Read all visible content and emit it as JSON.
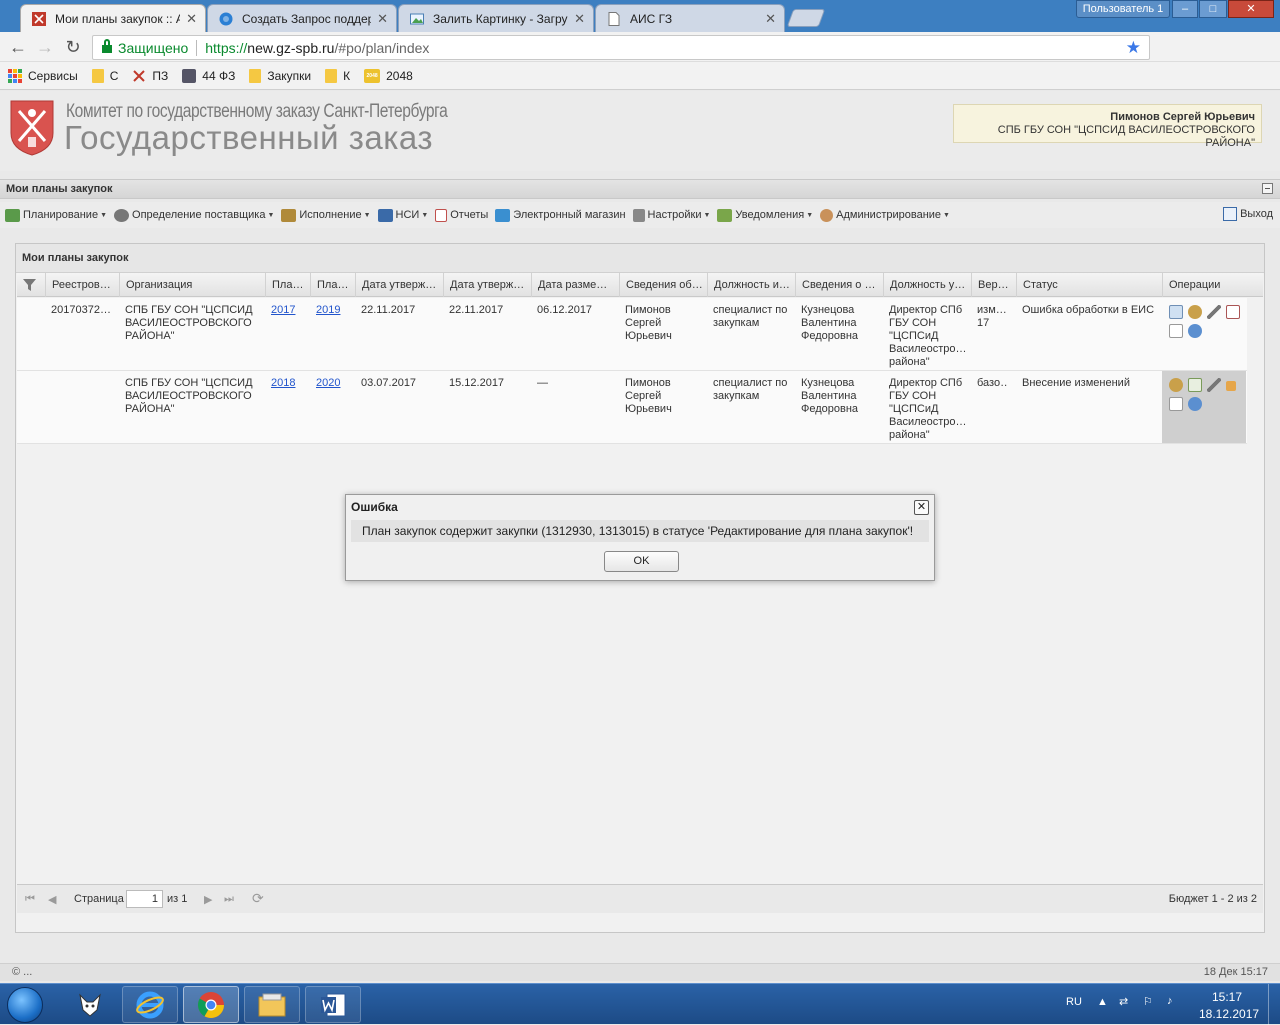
{
  "browser": {
    "tabs": [
      {
        "title": "Мои планы закупок :: АИС",
        "active": true
      },
      {
        "title": "Создать Запрос поддер",
        "active": false
      },
      {
        "title": "Залить Картинку - Загру",
        "active": false
      },
      {
        "title": "АИС ГЗ",
        "active": false
      }
    ],
    "user_label": "Пользователь 1",
    "window_controls": [
      "–",
      "□",
      "✕"
    ],
    "secure_label": "Защищено",
    "url": {
      "scheme": "https://",
      "host": "new.gz-spb.ru",
      "path": "/#po/plan/index"
    },
    "bookmarks": [
      {
        "label": "Сервисы",
        "icon": "apps-grid-icon"
      },
      {
        "label": "С",
        "icon": "folder-icon"
      },
      {
        "label": "ПЗ",
        "icon": "tools-icon"
      },
      {
        "label": "44 ФЗ",
        "icon": "image-icon"
      },
      {
        "label": "Закупки",
        "icon": "folder-icon"
      },
      {
        "label": "К",
        "icon": "folder-icon"
      },
      {
        "label": "2048",
        "icon": "game-2048-icon",
        "badge": "2048"
      }
    ]
  },
  "header": {
    "org_line1": "Комитет по государственному заказу Санкт-Петербурга",
    "org_line2": "Государственный заказ",
    "user_name": "Пимонов Сергей Юрьевич",
    "user_org": "СПБ ГБУ СОН \"ЦСПСИД ВАСИЛЕОСТРОВСКОГО РАЙОНА\""
  },
  "section_title": "Мои планы закупок",
  "menu": [
    {
      "label": "Планирование",
      "dropdown": true,
      "color": "#5a9a4a"
    },
    {
      "label": "Определение поставщика",
      "dropdown": true,
      "color": "#777777"
    },
    {
      "label": "Исполнение",
      "dropdown": true,
      "color": "#b08a3a"
    },
    {
      "label": "НСИ",
      "dropdown": true,
      "color": "#3a6aa8"
    },
    {
      "label": "Отчеты",
      "dropdown": false,
      "color": "#c0504d"
    },
    {
      "label": "Электронный магазин",
      "dropdown": false,
      "color": "#3a8fd0"
    },
    {
      "label": "Настройки",
      "dropdown": true,
      "color": "#777777"
    },
    {
      "label": "Уведомления",
      "dropdown": true,
      "color": "#7aa64a"
    },
    {
      "label": "Администрирование",
      "dropdown": true,
      "color": "#c9915a"
    }
  ],
  "logout_label": "Выход",
  "panel": {
    "title": "Мои планы закупок",
    "columns": [
      "Реестров…",
      "Организация",
      "Пла…",
      "Пла…",
      "Дата утверж…",
      "Дата утверж…",
      "Дата разме…",
      "Сведения об…",
      "Должность и…",
      "Сведения о …",
      "Должность у…",
      "Вер…",
      "Статус",
      "Операции"
    ],
    "rows": [
      {
        "reg": "20170372…",
        "org": "СПБ ГБУ СОН \"ЦСПСИД ВАСИЛЕОСТРОВСКОГО РАЙОНА\"",
        "plan_from": "2017",
        "plan_to": "2019",
        "approve1": "22.11.2017",
        "approve2": "22.11.2017",
        "placed": "06.12.2017",
        "resp": "Пимонов Сергей Юрьевич",
        "resp_pos": "специалист по закупкам",
        "approver": "Кузнецова Валентина Федоровна",
        "approver_pos": "Директор СПб ГБУ СОН \"ЦСПСиД Василеостро… района\"",
        "ver": "изм… 17",
        "status": "Ошибка обработки в ЕИС"
      },
      {
        "reg": "",
        "org": "СПБ ГБУ СОН \"ЦСПСИД ВАСИЛЕОСТРОВСКОГО РАЙОНА\"",
        "plan_from": "2018",
        "plan_to": "2020",
        "approve1": "03.07.2017",
        "approve2": "15.12.2017",
        "placed": "—",
        "resp": "Пимонов Сергей Юрьевич",
        "resp_pos": "специалист по закупкам",
        "approver": "Кузнецова Валентина Федоровна",
        "approver_pos": "Директор СПб ГБУ СОН \"ЦСПСиД Василеостро… района\"",
        "ver": "базо…",
        "status": "Внесение изменений"
      }
    ],
    "pager": {
      "page_label": "Страница",
      "page": "1",
      "of": "из 1",
      "summary": "Бюджет 1 - 2 из 2"
    }
  },
  "footer": {
    "left": "© ...",
    "right": "18 Дек 15:17"
  },
  "modal": {
    "title": "Ошибка",
    "message": "План закупок содержит закупки (1312930, 1313015) в статусе 'Редактирование для плана закупок'!",
    "ok": "OK"
  },
  "taskbar": {
    "lang": "RU",
    "time": "15:17",
    "date": "18.12.2017"
  }
}
